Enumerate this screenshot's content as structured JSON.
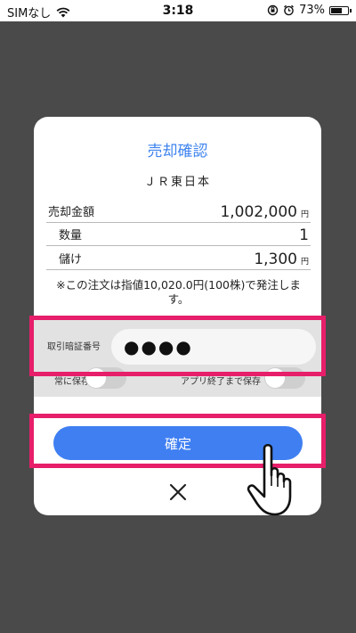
{
  "status_bar": {
    "carrier": "SIMなし",
    "time": "3:18",
    "battery_percent": "73%",
    "battery_level": 0.73
  },
  "dialog": {
    "title": "売却確認",
    "stock_name": "ＪＲ東日本",
    "rows": [
      {
        "label": "売却金額",
        "value": "1,002,000",
        "unit": "円"
      },
      {
        "label": "数量",
        "value": "1",
        "unit": ""
      },
      {
        "label": "儲け",
        "value": "1,300",
        "unit": "円"
      }
    ],
    "note_line1": "※この注文は指値10,020.0円(100株)で発注しま",
    "note_line2": "す。",
    "password_label": "取引暗証番号",
    "password_value": "●●●●",
    "always_save_label": "常に保存",
    "always_save_on": false,
    "save_until_exit_label": "アプリ終了まで保存",
    "save_until_exit_on": false,
    "confirm_label": "確定"
  },
  "icons": {
    "close": "close-icon",
    "pointer": "pointing-hand-icon",
    "wifi": "wifi-icon",
    "orientation_lock": "orientation-lock-icon",
    "alarm": "alarm-icon",
    "battery": "battery-icon"
  },
  "colors": {
    "accent": "#3f7ff2",
    "title": "#3f84ef",
    "highlight": "#e71e6a",
    "overlay": "#4a4a4a"
  }
}
